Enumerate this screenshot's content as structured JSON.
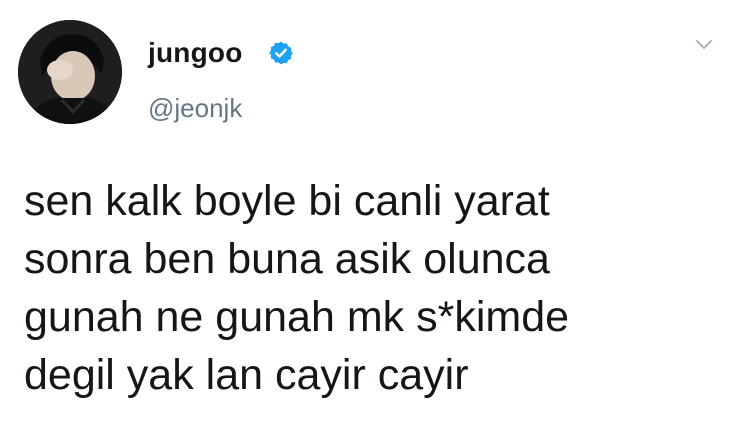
{
  "author": {
    "display_name": "jungoo",
    "handle": "@jeonjk",
    "verified": true
  },
  "tweet": {
    "lines": [
      "sen kalk boyle bi canli yarat",
      "sonra ben buna asik olunca",
      "gunah ne gunah mk s*kimde",
      "degil yak lan cayir cayir"
    ]
  },
  "icons": {
    "verified": "verified-badge-icon",
    "menu": "chevron-down-icon"
  },
  "colors": {
    "text": "#14171a",
    "secondary": "#657786",
    "verified_blue": "#1da1f2"
  }
}
